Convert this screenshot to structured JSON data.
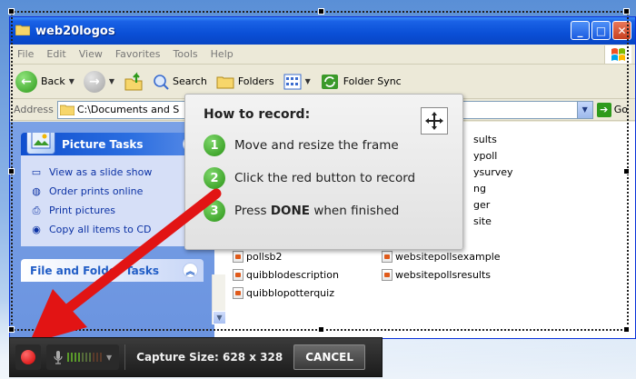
{
  "window": {
    "title": "web20logos",
    "menu": [
      "File",
      "Edit",
      "View",
      "Favorites",
      "Tools",
      "Help"
    ],
    "toolbar": {
      "back_label": "Back",
      "search_label": "Search",
      "folders_label": "Folders",
      "folder_sync_label": "Folder Sync"
    },
    "address": {
      "label": "Address",
      "value": "C:\\Documents and S",
      "go_label": "Go"
    }
  },
  "taskpane": {
    "picture_tasks": {
      "title": "Picture Tasks",
      "items": [
        {
          "label": "View as a slide show",
          "icon": "slideshow-icon"
        },
        {
          "label": "Order prints online",
          "icon": "globe-icon"
        },
        {
          "label": "Print pictures",
          "icon": "printer-icon"
        },
        {
          "label": "Copy all items to CD",
          "icon": "cd-icon"
        }
      ]
    },
    "file_folder_tasks": {
      "title": "File and Folder Tasks"
    }
  },
  "files": {
    "right_column": [
      "sults",
      "ypoll",
      "ysurvey",
      "ng",
      "ger",
      "site"
    ],
    "bottom_left": [
      "pollsb2",
      "quibblodescription",
      "quibblopotterquiz"
    ],
    "bottom_right": [
      "websitepollsexample",
      "websitepollsresults"
    ]
  },
  "howto": {
    "title": "How to record:",
    "steps": [
      {
        "num": "1",
        "text": "Move and resize the frame"
      },
      {
        "num": "2",
        "text": "Click the red button to record"
      },
      {
        "num": "3",
        "pre": "Press ",
        "bold": "DONE",
        "post": " when finished"
      }
    ]
  },
  "recorder": {
    "capture_size": "Capture Size: 628 x 328",
    "cancel_label": "CANCEL"
  },
  "colors": {
    "xp_title_blue": "#0a4fd6",
    "record_red": "#d40000",
    "arrow_red": "#e21414",
    "step_green": "#2a9416"
  }
}
